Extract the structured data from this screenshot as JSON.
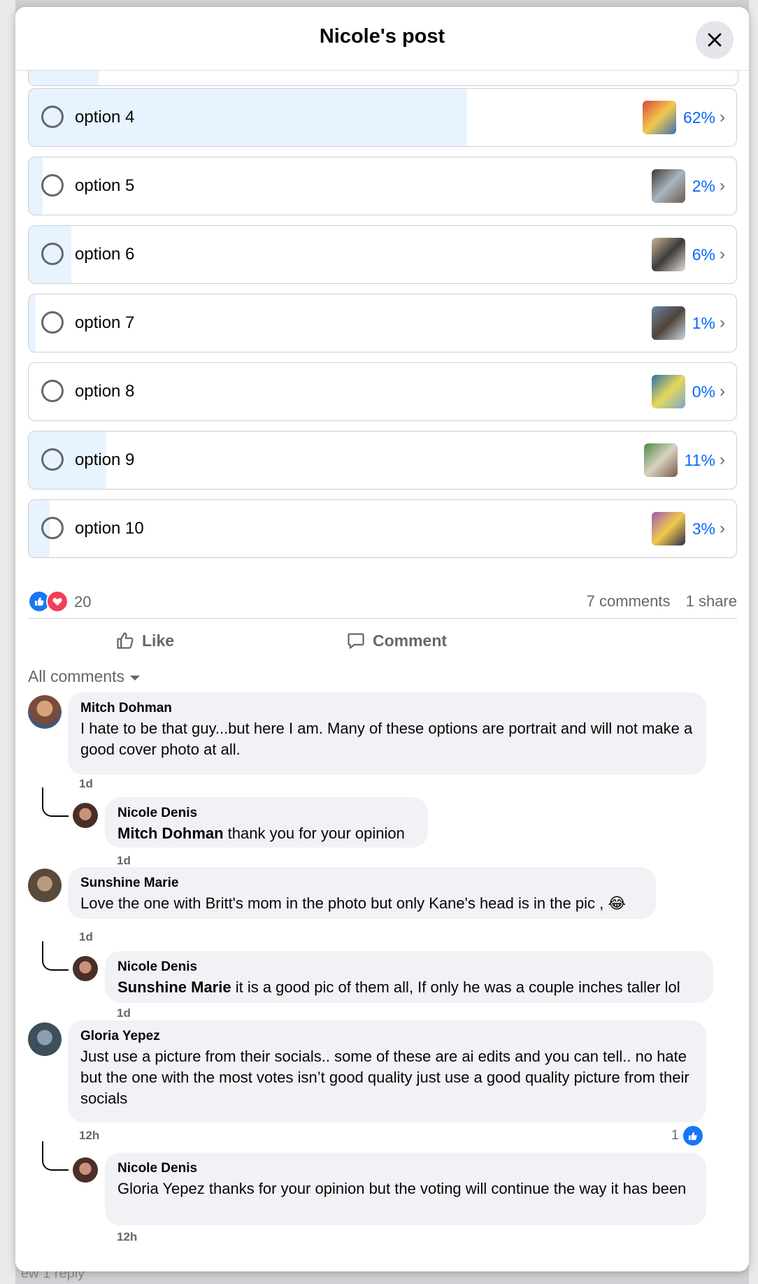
{
  "modal": {
    "title": "Nicole's post"
  },
  "poll": {
    "options": [
      {
        "label": "option 4",
        "percent": "62%",
        "fill": 0.62,
        "thumb_colors": [
          "#d9483b",
          "#f2c94c",
          "#3b6fb6"
        ]
      },
      {
        "label": "option 5",
        "percent": "2%",
        "fill": 0.02,
        "thumb_colors": [
          "#3d3a36",
          "#a9b5c0",
          "#6b5a4a"
        ]
      },
      {
        "label": "option 6",
        "percent": "6%",
        "fill": 0.06,
        "thumb_colors": [
          "#c9b79a",
          "#3e3a3a",
          "#e8e2d6"
        ]
      },
      {
        "label": "option 7",
        "percent": "1%",
        "fill": 0.01,
        "thumb_colors": [
          "#6a86a8",
          "#4f4339",
          "#cfd9e2"
        ]
      },
      {
        "label": "option 8",
        "percent": "0%",
        "fill": 0.0,
        "thumb_colors": [
          "#2a6fae",
          "#e6d85a",
          "#7aa7c8"
        ]
      },
      {
        "label": "option 9",
        "percent": "11%",
        "fill": 0.11,
        "thumb_colors": [
          "#4b8a3e",
          "#d9d3c2",
          "#7a5a48"
        ]
      },
      {
        "label": "option 10",
        "percent": "3%",
        "fill": 0.03,
        "thumb_colors": [
          "#9b59b6",
          "#f2c94c",
          "#2d2d4e"
        ]
      }
    ]
  },
  "reactions": {
    "count": "20",
    "comments": "7 comments",
    "shares": "1 share"
  },
  "actions": {
    "like": "Like",
    "comment": "Comment"
  },
  "sort_label": "All comments",
  "comments": [
    {
      "author": "Mitch Dohman",
      "text": "I hate to be that guy...but here I am. Many of these options are portrait and will not make a good cover photo at all.",
      "time": "1d",
      "reply": {
        "author": "Nicole Denis",
        "tag": "Mitch Dohman",
        "text": " thank you for your opinion",
        "time": "1d"
      }
    },
    {
      "author": "Sunshine Marie",
      "text": "Love the one with Britt's mom in the photo but only Kane's head is in the pic ,",
      "emoji": "😂",
      "time": "1d",
      "reply": {
        "author": "Nicole Denis",
        "tag": "Sunshine Marie",
        "text": " it is a good pic of them all, If only he was a couple inches taller lol",
        "time": "1d"
      }
    },
    {
      "author": "Gloria Yepez",
      "text": "Just use a picture from their socials.. some of these are ai edits and you can tell.. no hate but the one with the most votes isn’t good quality just use a good quality picture from their socials",
      "time": "12h",
      "likes": "1",
      "reply": {
        "author": "Nicole Denis",
        "text": "Gloria Yepez thanks for your opinion but the voting will continue the way it has been",
        "time": "12h"
      }
    }
  ],
  "backdrop": {
    "bottom_text": "ew 1 reply"
  },
  "colors": {
    "accent": "#0866ff",
    "poll_fill": "#e7f3ff",
    "bubble": "#f0f2f5"
  }
}
